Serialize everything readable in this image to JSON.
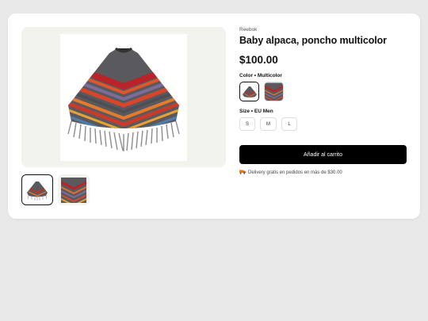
{
  "product": {
    "brand": "Reebok",
    "title": "Baby alpaca, poncho multicolor",
    "price": "$100.00"
  },
  "color": {
    "label": "Color • Multicolor",
    "options": [
      "poncho-multicolor",
      "poncho-striped"
    ],
    "selected": 0
  },
  "size": {
    "label": "Size • EU Men",
    "options": [
      "S",
      "M",
      "L"
    ]
  },
  "cart": {
    "button_label": "Añadir al carrito"
  },
  "delivery": {
    "text": "Delivery gratis en pedidos en más de $30.00",
    "icon": "truck-icon"
  },
  "gallery": {
    "thumbnails": [
      "poncho-front",
      "poncho-detail"
    ],
    "active": 0
  }
}
